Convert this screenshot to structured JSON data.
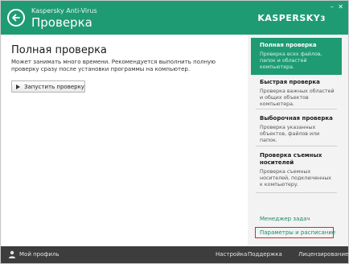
{
  "header": {
    "app_name": "Kaspersky Anti-Virus",
    "title": "Проверка",
    "logo": "KASPERSKY",
    "logo_suffix": "3",
    "accent_color": "#1f9b74"
  },
  "main": {
    "title": "Полная проверка",
    "description": "Может занимать много времени. Рекомендуется выполнить полную проверку сразу после установки программы на компьютер.",
    "start_button": "Запустить проверку"
  },
  "sidebar": {
    "items": [
      {
        "title": "Полная проверка",
        "desc": "Проверка всех файлов, папок и областей компьютера."
      },
      {
        "title": "Быстрая проверка",
        "desc": "Проверка важных областей и общих объектов компьютера."
      },
      {
        "title": "Выборочная проверка",
        "desc": "Проверка указанных объектов, файлов или папок."
      },
      {
        "title": "Проверка съемных носителей",
        "desc": "Проверка съемных носителей, подключенных к компьютеру."
      }
    ],
    "task_manager": "Менеджер задач",
    "schedule_settings": "Параметры и расписание"
  },
  "footer": {
    "profile": "Мой профиль",
    "settings": "Настройка",
    "support": "Поддержка",
    "license": "Лицензирование"
  }
}
